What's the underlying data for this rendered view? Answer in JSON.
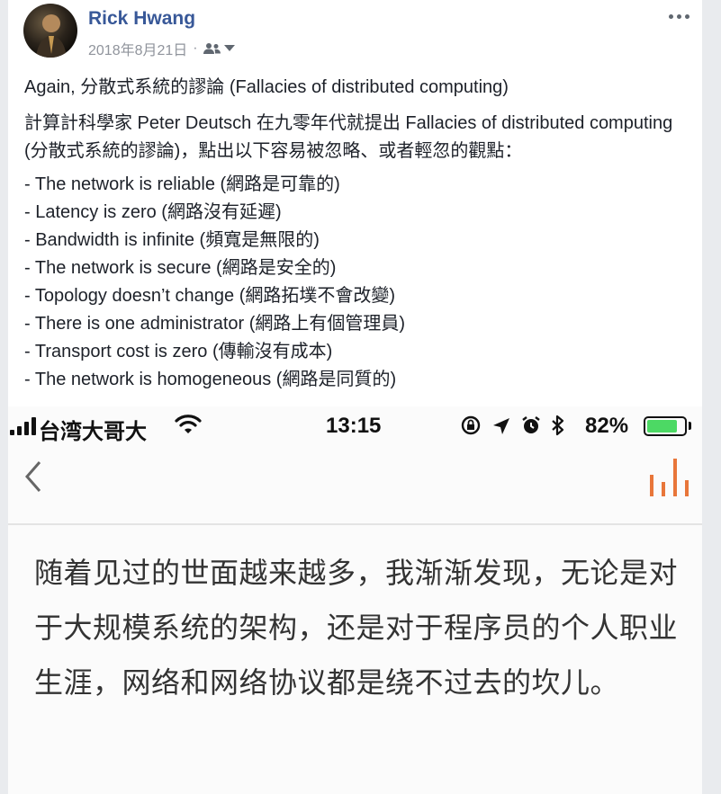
{
  "post": {
    "author": "Rick Hwang",
    "date": "2018年8月21日",
    "separator": "·",
    "icons": {
      "audience": "friends-icon",
      "dropdown": "caret-down-icon",
      "more": "more-options-icon"
    },
    "title": "Again, 分散式系統的謬論 (Fallacies of distributed computing)",
    "intro": "計算計科學家 Peter Deutsch 在九零年代就提出 Fallacies of distributed computing (分散式系統的謬論)，點出以下容易被忽略、或者輕忽的觀點：",
    "fallacies": [
      "- The network is reliable (網路是可靠的)",
      "- Latency is zero (網路沒有延遲)",
      "- Bandwidth is infinite (頻寬是無限的)",
      "- The network is secure (網路是安全的)",
      "- Topology doesn’t change (網路拓墣不會改變)",
      "- There is one administrator (網路上有個管理員)",
      "- Transport cost is zero (傳輸沒有成本)",
      "- The network is homogeneous (網路是同質的)"
    ]
  },
  "screenshot": {
    "status_bar": {
      "carrier": "台湾大哥大",
      "time": "13:15",
      "battery": "82%",
      "battery_level": 0.82,
      "icons": [
        "signal-icon",
        "wifi-icon",
        "orientation-lock-icon",
        "location-icon",
        "alarm-icon",
        "bluetooth-icon",
        "battery-icon"
      ]
    },
    "nav": {
      "back_icon": "back-arrow-icon",
      "right_icon": "bar-chart-icon",
      "accent_color": "#e8763a"
    },
    "article_text": "随着见过的世面越来越多，我渐渐发现，无论是对于大规模系统的架构，还是对于程序员的个人职业生涯，网络和网络协议都是绕不过去的坎儿。"
  },
  "colors": {
    "link": "#385898",
    "meta": "#90949c",
    "text": "#1d2129",
    "battery": "#4cd964"
  }
}
